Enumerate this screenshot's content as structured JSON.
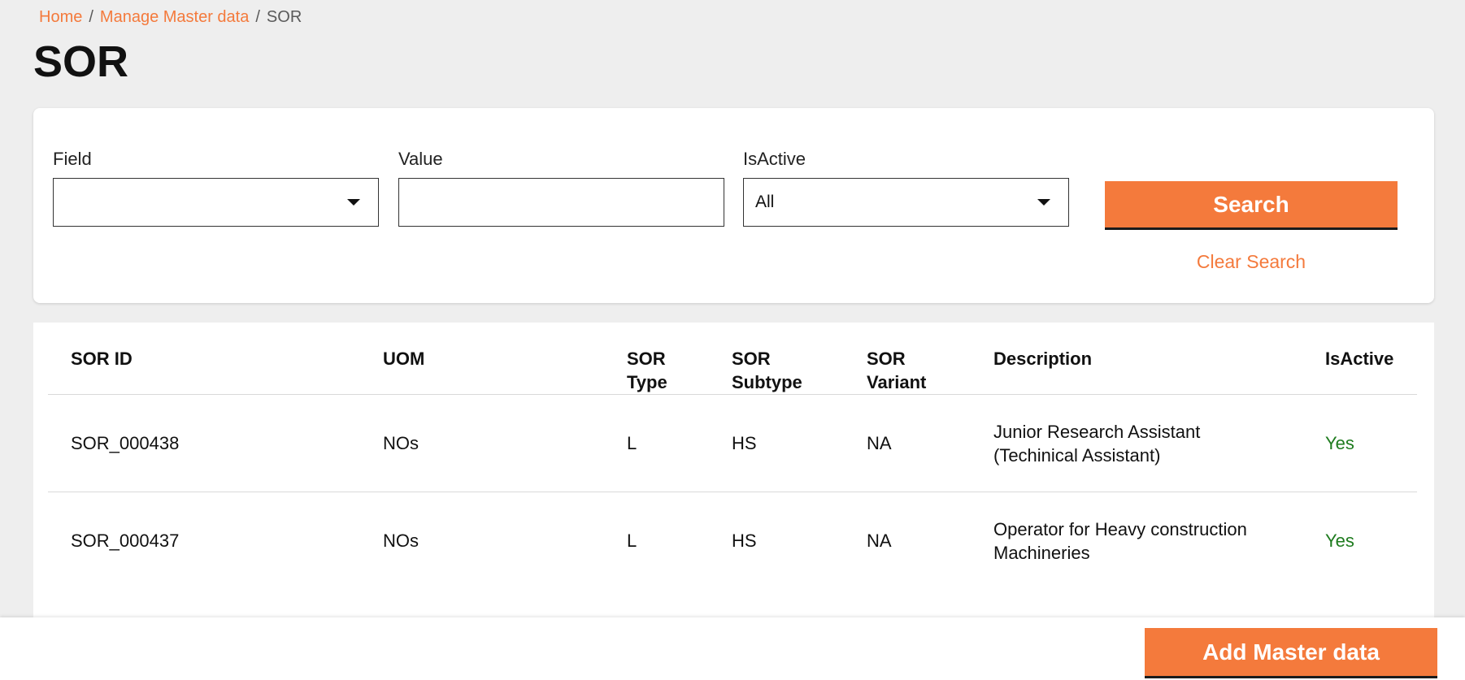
{
  "breadcrumb": {
    "items": [
      "Home",
      "Manage Master data",
      "SOR"
    ],
    "separator": "/"
  },
  "page": {
    "title": "SOR"
  },
  "filters": {
    "field_label": "Field",
    "field_value": "",
    "value_label": "Value",
    "value_value": "",
    "isactive_label": "IsActive",
    "isactive_value": "All",
    "search_label": "Search",
    "clear_label": "Clear Search"
  },
  "table": {
    "headers": [
      "SOR ID",
      "UOM",
      "SOR Type",
      "SOR Subtype",
      "SOR Variant",
      "Description",
      "IsActive"
    ],
    "rows": [
      {
        "sor_id": "SOR_000438",
        "uom": "NOs",
        "type": "L",
        "subtype": "HS",
        "variant": "NA",
        "description": "Junior Research Assistant (Techinical Assistant)",
        "isactive": "Yes"
      },
      {
        "sor_id": "SOR_000437",
        "uom": "NOs",
        "type": "L",
        "subtype": "HS",
        "variant": "NA",
        "description": "Operator for Heavy construction Machineries",
        "isactive": "Yes"
      }
    ]
  },
  "footer": {
    "add_label": "Add Master data"
  },
  "colors": {
    "accent": "#f47a3c",
    "active_green": "#1e7b1e",
    "background": "#eeeeee"
  }
}
